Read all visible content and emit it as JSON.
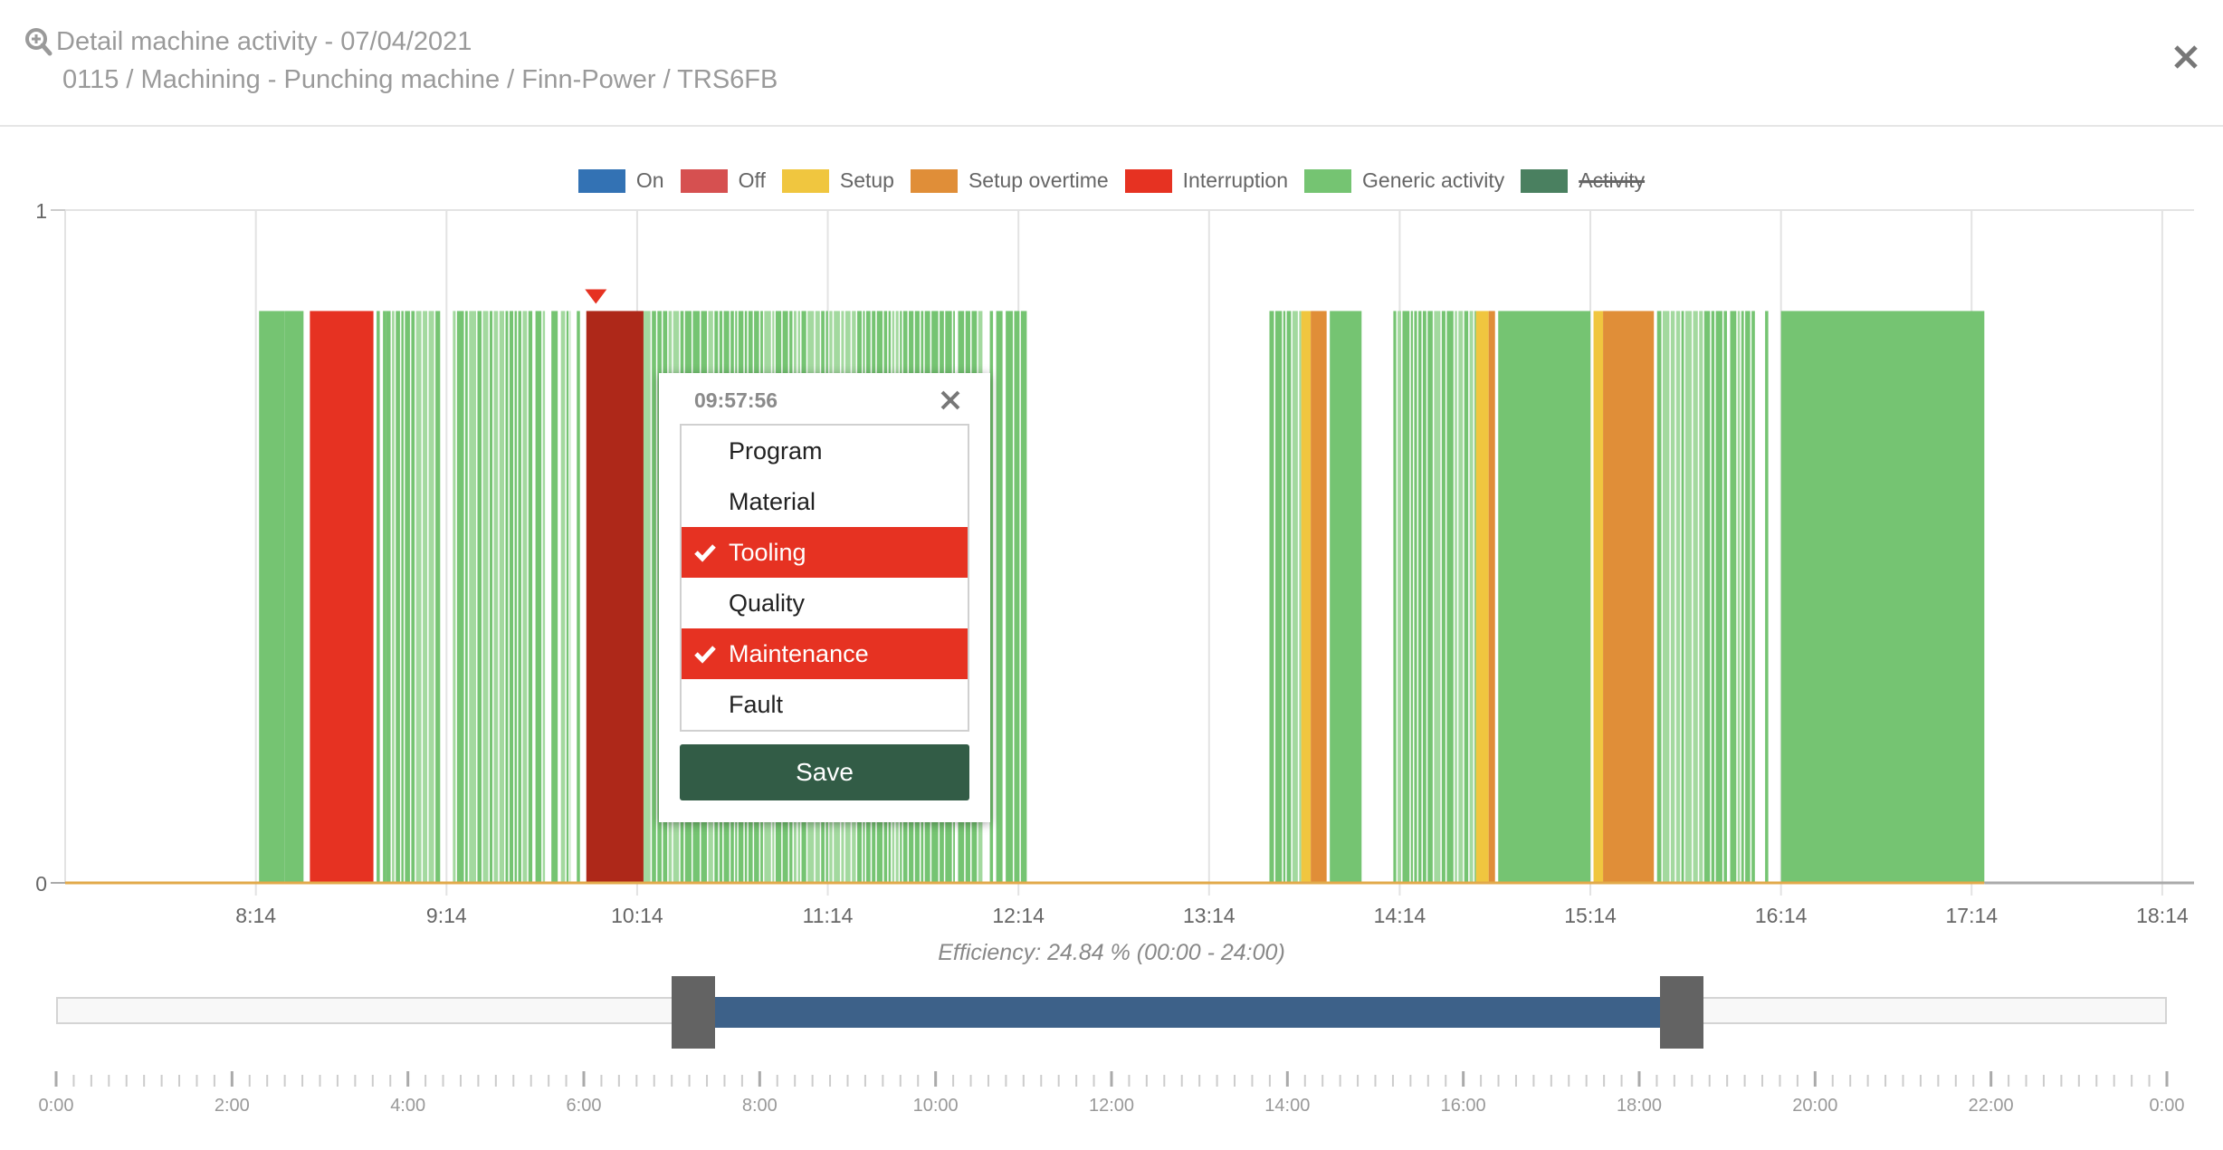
{
  "header": {
    "title": "Detail machine activity - 07/04/2021",
    "subtitle": "0115 / Machining - Punching machine / Finn-Power / TRS6FB"
  },
  "legend": [
    {
      "label": "On",
      "color": "#3372b4",
      "hidden": false
    },
    {
      "label": "Off",
      "color": "#d65050",
      "hidden": false
    },
    {
      "label": "Setup",
      "color": "#f0c63f",
      "hidden": false
    },
    {
      "label": "Setup overtime",
      "color": "#e08e38",
      "hidden": false
    },
    {
      "label": "Interruption",
      "color": "#e63222",
      "hidden": false
    },
    {
      "label": "Generic activity",
      "color": "#75c472",
      "hidden": false
    },
    {
      "label": "Activity",
      "color": "#4a8060",
      "hidden": true
    }
  ],
  "chart_data": {
    "type": "bar",
    "title": "",
    "xlabel": "",
    "ylabel": "",
    "ylim": [
      0,
      1
    ],
    "y_ticks": [
      "0",
      "1"
    ],
    "x_domain_hours": [
      7.233,
      18.4
    ],
    "x_ticks": [
      "8:14",
      "9:14",
      "10:14",
      "11:14",
      "12:14",
      "13:14",
      "14:14",
      "15:14",
      "16:14",
      "17:14",
      "18:14"
    ],
    "grid": true,
    "legend_position": "top",
    "bar_value": 0.85,
    "marker_time": "10:01",
    "colors": {
      "generic": "#75c472",
      "generic_light": "#a3d99f",
      "interruption": "#e63222",
      "interruption_selected": "#ae2819",
      "setup": "#f0c63f",
      "setup_overtime": "#e08e38",
      "baseline": "#e2a94a"
    },
    "segments": [
      {
        "start": "8:15",
        "end": "8:23",
        "type": "generic"
      },
      {
        "start": "8:23",
        "end": "8:29",
        "type": "generic"
      },
      {
        "start": "8:31",
        "end": "8:51",
        "type": "interruption"
      },
      {
        "start": "8:52",
        "end": "8:53",
        "type": "generic"
      },
      {
        "start": "8:54",
        "end": "8:55",
        "type": "generic"
      },
      {
        "start": "8:55",
        "end": "9:12",
        "type": "generic_striped"
      },
      {
        "start": "9:16",
        "end": "9:41",
        "type": "generic_striped"
      },
      {
        "start": "9:42",
        "end": "9:45",
        "type": "generic_striped"
      },
      {
        "start": "9:47",
        "end": "9:49",
        "type": "generic"
      },
      {
        "start": "9:50",
        "end": "9:53",
        "type": "generic_striped"
      },
      {
        "start": "9:55",
        "end": "9:56",
        "type": "generic"
      },
      {
        "start": "9:58",
        "end": "10:16",
        "type": "interruption_selected"
      },
      {
        "start": "10:16",
        "end": "11:54",
        "type": "generic_striped"
      },
      {
        "start": "11:55",
        "end": "12:03",
        "type": "generic_striped"
      },
      {
        "start": "12:05",
        "end": "12:06",
        "type": "generic"
      },
      {
        "start": "12:07",
        "end": "12:09",
        "type": "generic"
      },
      {
        "start": "12:10",
        "end": "12:17",
        "type": "generic_striped"
      },
      {
        "start": "13:33",
        "end": "13:43",
        "type": "generic_striped"
      },
      {
        "start": "13:43",
        "end": "13:46",
        "type": "setup"
      },
      {
        "start": "13:46",
        "end": "13:51",
        "type": "setup_overtime"
      },
      {
        "start": "13:52",
        "end": "14:02",
        "type": "generic"
      },
      {
        "start": "14:12",
        "end": "14:38",
        "type": "generic_striped"
      },
      {
        "start": "14:38",
        "end": "14:42",
        "type": "setup"
      },
      {
        "start": "14:42",
        "end": "14:44",
        "type": "setup_overtime"
      },
      {
        "start": "14:45",
        "end": "15:14",
        "type": "generic"
      },
      {
        "start": "15:15",
        "end": "15:18",
        "type": "setup"
      },
      {
        "start": "15:18",
        "end": "15:34",
        "type": "setup_overtime"
      },
      {
        "start": "15:35",
        "end": "15:57",
        "type": "generic_striped"
      },
      {
        "start": "15:58",
        "end": "16:06",
        "type": "generic_striped"
      },
      {
        "start": "16:09",
        "end": "16:10",
        "type": "generic"
      },
      {
        "start": "16:14",
        "end": "17:18",
        "type": "generic"
      }
    ],
    "efficiency_text": "Efficiency: 24.84 % (00:00 - 24:00)"
  },
  "brush": {
    "range_start": "7:00",
    "range_end": "18:14",
    "ticks": [
      "0:00",
      "2:00",
      "4:00",
      "6:00",
      "8:00",
      "10:00",
      "12:00",
      "14:00",
      "16:00",
      "18:00",
      "20:00",
      "22:00",
      "0:00"
    ]
  },
  "popup": {
    "time": "09:57:56",
    "options": [
      {
        "label": "Program",
        "selected": false
      },
      {
        "label": "Material",
        "selected": false
      },
      {
        "label": "Tooling",
        "selected": true
      },
      {
        "label": "Quality",
        "selected": false
      },
      {
        "label": "Maintenance",
        "selected": true
      },
      {
        "label": "Fault",
        "selected": false
      }
    ],
    "save_label": "Save"
  }
}
